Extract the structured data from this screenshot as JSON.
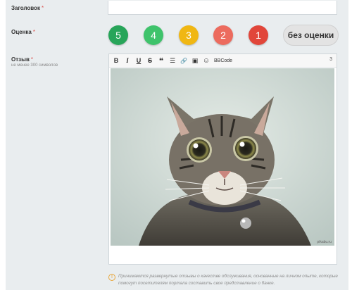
{
  "form": {
    "title_label": "Заголовок",
    "rating_label": "Оценка",
    "review_label": "Отзыв",
    "required_mark": "*",
    "review_hint": "не менее 300 символов",
    "title_value": ""
  },
  "rating": {
    "options": [
      {
        "label": "5",
        "color": "#27a559"
      },
      {
        "label": "4",
        "color": "#3ec36b"
      },
      {
        "label": "3",
        "color": "#f0b713"
      },
      {
        "label": "2",
        "color": "#ec6b5e"
      },
      {
        "label": "1",
        "color": "#e1463a"
      }
    ],
    "no_rating_label": "без оценки"
  },
  "editor": {
    "toolbar": [
      {
        "label": "B",
        "icon": "bold-icon"
      },
      {
        "label": "I",
        "icon": "italic-icon"
      },
      {
        "label": "U",
        "icon": "underline-icon"
      },
      {
        "label": "S",
        "icon": "strikethrough-icon"
      },
      {
        "label": "❝",
        "icon": "quote-icon"
      },
      {
        "label": "☰",
        "icon": "list-icon"
      },
      {
        "label": "🔗",
        "icon": "link-icon"
      },
      {
        "label": "▣",
        "icon": "image-icon"
      },
      {
        "label": "☺",
        "icon": "smiley-icon"
      }
    ],
    "bbcode_label": "BBCode",
    "counter": "3",
    "image_watermark": "pikabu.ru"
  },
  "footer": {
    "note_icon": "!",
    "note_text": "Принимаются развернутые отзывы о качестве обслуживания, основанные на личном опыте, которые помогут посетителям портала составить свое представление о банке."
  }
}
